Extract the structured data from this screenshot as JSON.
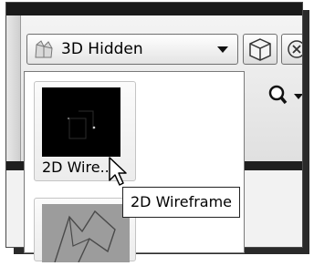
{
  "visual_style": {
    "combo": {
      "label": "3D Hidden",
      "icon": "3d-hidden-icon"
    },
    "gallery": {
      "items": [
        {
          "label": "2D Wire...",
          "icon": "2d-wireframe-icon"
        },
        {
          "label": "",
          "icon": "3d-wireframe-icon"
        }
      ]
    },
    "tooltip": "2D Wireframe"
  },
  "toolbar_icons": {
    "view_cube": "cube-icon",
    "close": "close-icon",
    "zoom": "zoom-icon"
  }
}
